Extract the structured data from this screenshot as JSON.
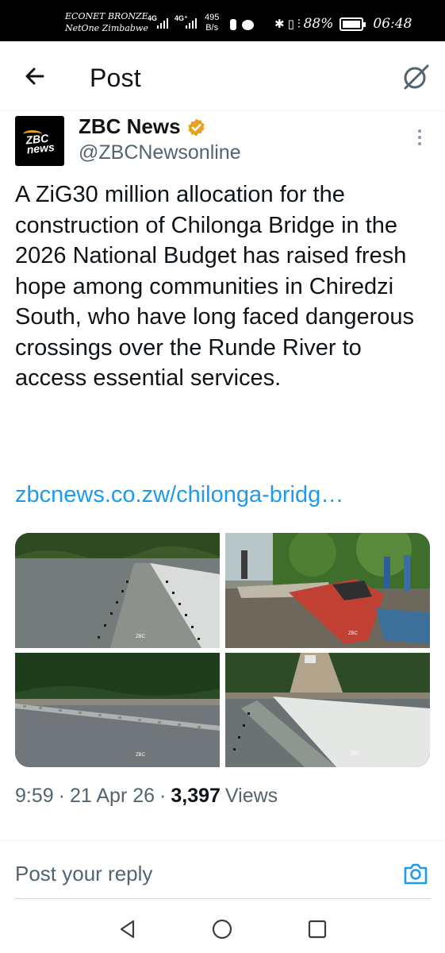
{
  "status_bar": {
    "carrier_1": "ECONET BRONZE",
    "carrier_2": "NetOne Zimbabwe",
    "network_1": "4G",
    "network_2": "4G⁺",
    "speed_value": "495",
    "speed_unit": "B/s",
    "battery_percent": "88%",
    "time": "06:48"
  },
  "header": {
    "title": "Post"
  },
  "post": {
    "display_name": "ZBC News",
    "handle": "@ZBCNewsonline",
    "avatar_text": "ZBC news",
    "text": "A ZiG30 million allocation for the construction of Chilonga Bridge in the 2026 National Budget has raised fresh hope among communities in Chiredzi South, who have long faced dangerous crossings over the Runde River to access essential services.",
    "link": "zbcnews.co.zw/chilonga-bridg…",
    "watermark": "ZBC",
    "time": "9:59",
    "date": "21 Apr 26",
    "separator": "·",
    "views_count": "3,397",
    "views_label": "Views"
  },
  "reply": {
    "placeholder": "Post your reply"
  },
  "icons": {
    "back": "arrow-left-icon",
    "grok": "grok-icon",
    "verified": "verified-badge-icon",
    "more": "more-vertical-icon",
    "camera": "camera-icon",
    "nav_back": "triangle-back-icon",
    "nav_home": "circle-home-icon",
    "nav_recent": "square-recent-icon"
  },
  "colors": {
    "link": "#1d9bf0",
    "verified": "#e8a21a",
    "secondary_text": "#536471"
  }
}
